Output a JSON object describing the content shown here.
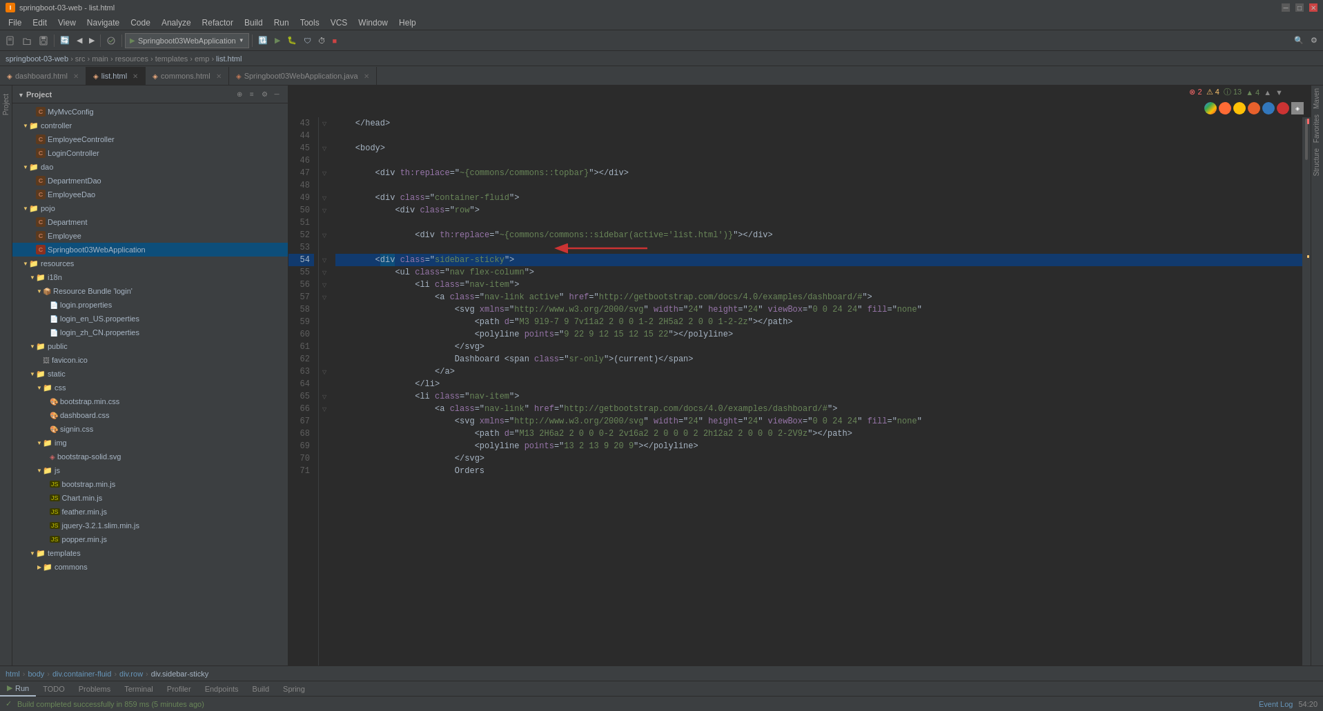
{
  "window": {
    "title": "springboot-03-web - list.html",
    "titlebar_buttons": [
      "minimize",
      "maximize",
      "close"
    ]
  },
  "menu": {
    "items": [
      "File",
      "Edit",
      "View",
      "Navigate",
      "Code",
      "Analyze",
      "Refactor",
      "Build",
      "Run",
      "Tools",
      "VCS",
      "Window",
      "Help"
    ]
  },
  "toolbar": {
    "project_selector": "Springboot03WebApplication",
    "buttons": [
      "open",
      "save_all",
      "sync",
      "back",
      "forward",
      "select",
      "sync2",
      "run",
      "debug",
      "coverage",
      "profile",
      "stop",
      "search",
      "settings"
    ]
  },
  "breadcrumb": {
    "items": [
      "springboot-03-web",
      "src",
      "main",
      "resources",
      "templates",
      "emp",
      "list.html"
    ]
  },
  "tabs": [
    {
      "label": "dashboard.html",
      "active": false,
      "icon": "html"
    },
    {
      "label": "list.html",
      "active": true,
      "icon": "html"
    },
    {
      "label": "commons.html",
      "active": false,
      "icon": "html"
    },
    {
      "label": "Springboot03WebApplication.java",
      "active": false,
      "icon": "java"
    }
  ],
  "project_panel": {
    "title": "Project",
    "tree": [
      {
        "id": 1,
        "indent": 2,
        "type": "java",
        "label": "MyMvcConfig",
        "expanded": false
      },
      {
        "id": 2,
        "indent": 1,
        "type": "folder",
        "label": "controller",
        "expanded": true
      },
      {
        "id": 3,
        "indent": 2,
        "type": "java",
        "label": "EmployeeController",
        "expanded": false
      },
      {
        "id": 4,
        "indent": 2,
        "type": "java",
        "label": "LoginController",
        "expanded": false
      },
      {
        "id": 5,
        "indent": 1,
        "type": "folder",
        "label": "dao",
        "expanded": true
      },
      {
        "id": 6,
        "indent": 2,
        "type": "java",
        "label": "DepartmentDao",
        "expanded": false
      },
      {
        "id": 7,
        "indent": 2,
        "type": "java",
        "label": "EmployeeDao",
        "expanded": false
      },
      {
        "id": 8,
        "indent": 1,
        "type": "folder",
        "label": "pojo",
        "expanded": true
      },
      {
        "id": 9,
        "indent": 2,
        "type": "java",
        "label": "Department",
        "expanded": false
      },
      {
        "id": 10,
        "indent": 2,
        "type": "java",
        "label": "Employee",
        "expanded": false
      },
      {
        "id": 11,
        "indent": 2,
        "type": "java_selected",
        "label": "Springboot03WebApplication",
        "expanded": false
      },
      {
        "id": 12,
        "indent": 1,
        "type": "folder",
        "label": "resources",
        "expanded": true
      },
      {
        "id": 13,
        "indent": 2,
        "type": "folder",
        "label": "i18n",
        "expanded": true
      },
      {
        "id": 14,
        "indent": 3,
        "type": "bundle",
        "label": "Resource Bundle 'login'",
        "expanded": true
      },
      {
        "id": 15,
        "indent": 4,
        "type": "properties",
        "label": "login.properties",
        "expanded": false
      },
      {
        "id": 16,
        "indent": 4,
        "type": "properties",
        "label": "login_en_US.properties",
        "expanded": false
      },
      {
        "id": 17,
        "indent": 4,
        "type": "properties",
        "label": "login_zh_CN.properties",
        "expanded": false
      },
      {
        "id": 18,
        "indent": 2,
        "type": "folder",
        "label": "public",
        "expanded": true
      },
      {
        "id": 19,
        "indent": 3,
        "type": "image",
        "label": "favicon.ico",
        "expanded": false
      },
      {
        "id": 20,
        "indent": 2,
        "type": "folder",
        "label": "static",
        "expanded": true
      },
      {
        "id": 21,
        "indent": 3,
        "type": "folder",
        "label": "css",
        "expanded": true
      },
      {
        "id": 22,
        "indent": 4,
        "type": "css",
        "label": "bootstrap.min.css",
        "expanded": false
      },
      {
        "id": 23,
        "indent": 4,
        "type": "css",
        "label": "dashboard.css",
        "expanded": false
      },
      {
        "id": 24,
        "indent": 4,
        "type": "css",
        "label": "signin.css",
        "expanded": false
      },
      {
        "id": 25,
        "indent": 3,
        "type": "folder",
        "label": "img",
        "expanded": true
      },
      {
        "id": 26,
        "indent": 4,
        "type": "svg",
        "label": "bootstrap-solid.svg",
        "expanded": false
      },
      {
        "id": 27,
        "indent": 3,
        "type": "folder",
        "label": "js",
        "expanded": true
      },
      {
        "id": 28,
        "indent": 4,
        "type": "js",
        "label": "bootstrap.min.js",
        "expanded": false
      },
      {
        "id": 29,
        "indent": 4,
        "type": "js",
        "label": "Chart.min.js",
        "expanded": false
      },
      {
        "id": 30,
        "indent": 4,
        "type": "js",
        "label": "feather.min.js",
        "expanded": false
      },
      {
        "id": 31,
        "indent": 4,
        "type": "js",
        "label": "jquery-3.2.1.slim.min.js",
        "expanded": false
      },
      {
        "id": 32,
        "indent": 4,
        "type": "js",
        "label": "popper.min.js",
        "expanded": false
      },
      {
        "id": 33,
        "indent": 2,
        "type": "folder",
        "label": "templates",
        "expanded": true
      },
      {
        "id": 34,
        "indent": 3,
        "type": "folder",
        "label": "commons",
        "expanded": false
      }
    ]
  },
  "editor": {
    "filename": "list.html",
    "lines": [
      {
        "num": 43,
        "content": "    </head>",
        "type": "plain"
      },
      {
        "num": 44,
        "content": "",
        "type": "plain"
      },
      {
        "num": 45,
        "content": "    <body>",
        "type": "plain"
      },
      {
        "num": 46,
        "content": "",
        "type": "plain"
      },
      {
        "num": 47,
        "content": "        <div th:replace=\"~{commons/commons::topbar}\"></div>",
        "type": "code"
      },
      {
        "num": 48,
        "content": "",
        "type": "plain"
      },
      {
        "num": 49,
        "content": "        <div class=\"container-fluid\">",
        "type": "code"
      },
      {
        "num": 50,
        "content": "            <div class=\"row\">",
        "type": "code"
      },
      {
        "num": 51,
        "content": "",
        "type": "plain"
      },
      {
        "num": 52,
        "content": "                <div th:replace=\"~{commons/commons::sidebar(active='list.html')}\"></div>",
        "type": "code"
      },
      {
        "num": 53,
        "content": "",
        "type": "plain"
      },
      {
        "num": 54,
        "content": "        <div class=\"sidebar-sticky\">",
        "type": "code",
        "selected": true
      },
      {
        "num": 55,
        "content": "            <ul class=\"nav flex-column\">",
        "type": "code"
      },
      {
        "num": 56,
        "content": "                <li class=\"nav-item\">",
        "type": "code"
      },
      {
        "num": 57,
        "content": "                    <a class=\"nav-link active\" href=\"http://getbootstrap.com/docs/4.0/examples/dashboard/#\">",
        "type": "code"
      },
      {
        "num": 58,
        "content": "                        <svg xmlns=\"http://www.w3.org/2000/svg\" width=\"24\" height=\"24\" viewBox=\"0 0 24 24\" fill=\"none\"",
        "type": "code"
      },
      {
        "num": 59,
        "content": "                            <path d=\"M3 9l9-7 9 7v11a2 2 0 0 1-2 2H5a2 2 0 0 1-2-2z\"></path>",
        "type": "code"
      },
      {
        "num": 60,
        "content": "                            <polyline points=\"9 22 9 12 15 12 15 22\"></polyline>",
        "type": "code"
      },
      {
        "num": 61,
        "content": "                        </svg>",
        "type": "code"
      },
      {
        "num": 62,
        "content": "                        Dashboard <span class=\"sr-only\">(current)</span>",
        "type": "code"
      },
      {
        "num": 63,
        "content": "                    </a>",
        "type": "code"
      },
      {
        "num": 64,
        "content": "                </li>",
        "type": "code"
      },
      {
        "num": 65,
        "content": "                <li class=\"nav-item\">",
        "type": "code"
      },
      {
        "num": 66,
        "content": "                    <a class=\"nav-link\" href=\"http://getbootstrap.com/docs/4.0/examples/dashboard/#\">",
        "type": "code"
      },
      {
        "num": 67,
        "content": "                        <svg xmlns=\"http://www.w3.org/2000/svg\" width=\"24\" height=\"24\" viewBox=\"0 0 24 24\" fill=\"none\"",
        "type": "code"
      },
      {
        "num": 68,
        "content": "                            <path d=\"M13 2H6a2 2 0 0 0-2 2v16a2 2 0 0 0 2 2h12a2 2 0 0 0 2-2V9z\"></path>",
        "type": "code"
      },
      {
        "num": 69,
        "content": "                            <polyline points=\"13 2 13 9 20 9\"></polyline>",
        "type": "code"
      },
      {
        "num": 70,
        "content": "                        </svg>",
        "type": "code"
      },
      {
        "num": 71,
        "content": "                        Orders",
        "type": "code"
      }
    ]
  },
  "notifications": {
    "errors": "2",
    "warnings": "4",
    "info1": "13",
    "info2": "4"
  },
  "bottom_breadcrumb": {
    "items": [
      "html",
      "body",
      "div.container-fluid",
      "div.row",
      "div.sidebar-sticky"
    ]
  },
  "bottom_tabs": [
    {
      "label": "Run",
      "icon": "run"
    },
    {
      "label": "TODO"
    },
    {
      "label": "Problems"
    },
    {
      "label": "Terminal"
    },
    {
      "label": "Profiler"
    },
    {
      "label": "Endpoints"
    },
    {
      "label": "Build"
    },
    {
      "label": "Spring"
    }
  ],
  "status_bar": {
    "left": "Build completed successfully in 859 ms (5 minutes ago)",
    "right_time": "54:20",
    "event_log": "Event Log"
  }
}
